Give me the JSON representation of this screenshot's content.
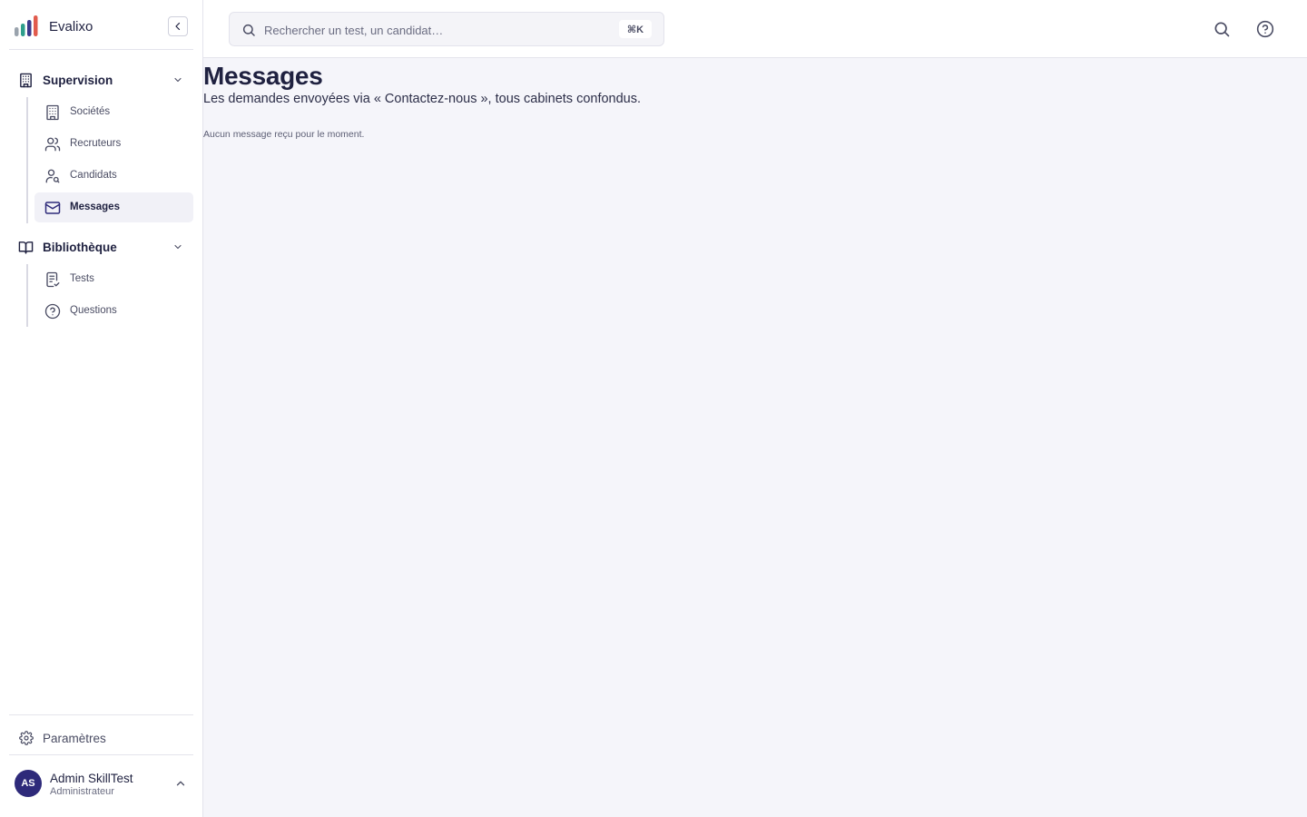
{
  "app": {
    "name": "Evalixo",
    "logo_colors": [
      "#9aa3ad",
      "#2e9e8c",
      "#3a3a8c",
      "#e15b4d"
    ]
  },
  "sidebar": {
    "sections": [
      {
        "label": "Supervision",
        "icon": "building-icon",
        "items": [
          {
            "label": "Sociétés",
            "icon": "building-icon"
          },
          {
            "label": "Recruteurs",
            "icon": "users-icon"
          },
          {
            "label": "Candidats",
            "icon": "user-search-icon"
          },
          {
            "label": "Messages",
            "icon": "mail-icon",
            "active": true
          }
        ]
      },
      {
        "label": "Bibliothèque",
        "icon": "book-open-icon",
        "items": [
          {
            "label": "Tests",
            "icon": "clipboard-check-icon"
          },
          {
            "label": "Questions",
            "icon": "help-circle-icon"
          }
        ]
      }
    ],
    "settings_label": "Paramètres",
    "user": {
      "initials": "AS",
      "name": "Admin SkillTest",
      "role": "Administrateur"
    }
  },
  "topbar": {
    "search_placeholder": "Rechercher un test, un candidat…",
    "search_value": "",
    "shortcut": "⌘K"
  },
  "page": {
    "title": "Messages",
    "subtitle": "Les demandes envoyées via « Contactez-nous », tous cabinets confondus.",
    "empty_state": "Aucun message reçu pour le moment."
  },
  "colors": {
    "accent": "#2e2a7a",
    "active_bg": "#f1f1f7",
    "background": "#f5f5fa"
  }
}
